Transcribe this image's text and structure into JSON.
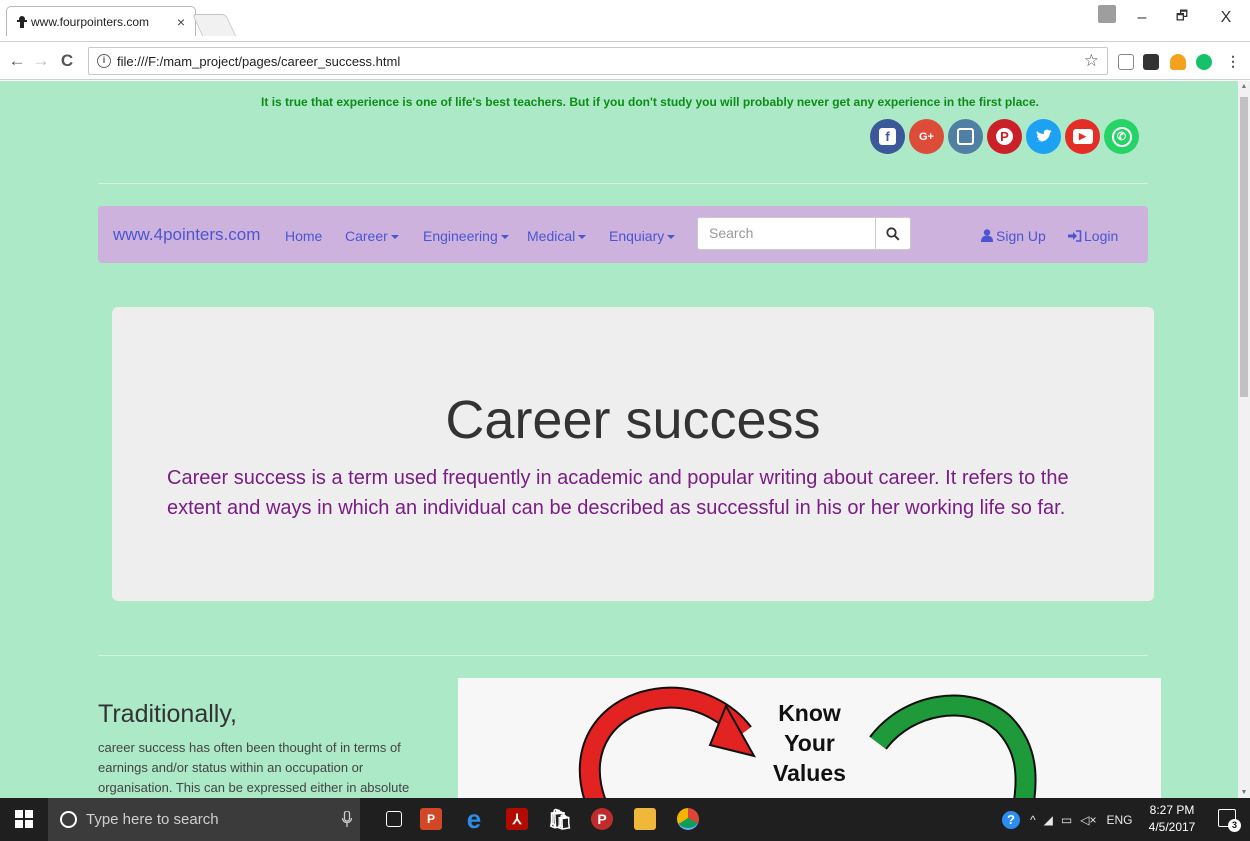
{
  "browser": {
    "tab_title": "www.fourpointers.com",
    "tab_close": "×",
    "url": "file:///F:/mam_project/pages/career_success.html",
    "minimize": "–",
    "restore": "🗗",
    "close": "X",
    "back": "←",
    "forward": "→",
    "reload": "C",
    "info": "i",
    "star": "☆"
  },
  "page": {
    "quote": "It is true that experience is one of life's best teachers. But if you don't study you will probably never get any experience in the first place.",
    "social": [
      {
        "name": "facebook",
        "glyph": "f",
        "color": "#3b5998"
      },
      {
        "name": "google-plus",
        "glyph": "G+",
        "color": "#dd4b39"
      },
      {
        "name": "instagram",
        "glyph": "◘",
        "color": "#517fa4"
      },
      {
        "name": "pinterest",
        "glyph": "P",
        "color": "#cb2027"
      },
      {
        "name": "twitter",
        "glyph": "t",
        "color": "#1da1f2"
      },
      {
        "name": "youtube",
        "glyph": "▶",
        "color": "#e52d27"
      },
      {
        "name": "whatsapp",
        "glyph": "✆",
        "color": "#25d366"
      }
    ],
    "navbar": {
      "brand": "www.4pointers.com",
      "links": {
        "home": "Home",
        "career": "Career",
        "engineering": "Engineering",
        "medical": "Medical",
        "enquiry": "Enquiary"
      },
      "search_placeholder": "Search",
      "signup": "Sign Up",
      "login": "Login"
    },
    "jumbotron": {
      "title": "Career success",
      "text": "Career success is a term used frequently in academic and popular writing about career. It refers to the extent and ways in which an individual can be described as successful in his or her working life so far."
    },
    "section": {
      "heading": "Traditionally,",
      "text": "career success has often been thought of in terms of earnings and/or status within an occupation or organisation. This can be expressed either in absolute"
    },
    "figure": {
      "line1": "Know",
      "line2": "Your",
      "line3": "Values"
    }
  },
  "taskbar": {
    "search_placeholder": "Type here to search",
    "lang": "ENG",
    "time": "8:27 PM",
    "date": "4/5/2017",
    "notifications": "3"
  },
  "colors": {
    "page_bg": "#abe9c7",
    "navbar_bg": "#cdb2de",
    "nav_text": "#4c55d0",
    "quote_text": "#0f8c17",
    "jumbo_text": "#7a1d85"
  }
}
